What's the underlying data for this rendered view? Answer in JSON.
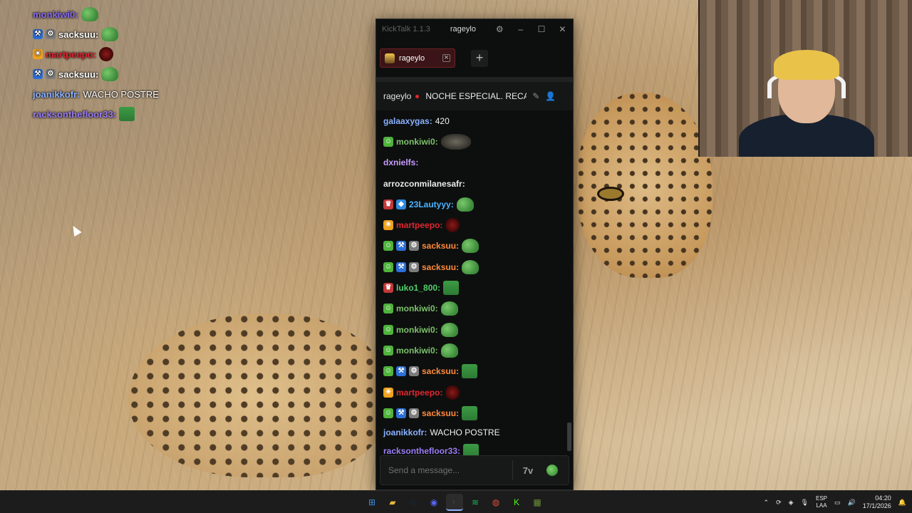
{
  "overlay_chat": [
    {
      "user": "monkiwi0:",
      "color": "#8a6cf0",
      "message": "",
      "emote": "frog",
      "badges": []
    },
    {
      "user": "sacksuu:",
      "color": "#ffffff",
      "message": "",
      "emote": "frog",
      "badges": [
        "pickaxe",
        "gear"
      ]
    },
    {
      "user": "martpeepo:",
      "color": "#e0262f",
      "message": "",
      "emote": "red",
      "badges": [
        "sun"
      ]
    },
    {
      "user": "sacksuu:",
      "color": "#ffffff",
      "message": "",
      "emote": "frog",
      "badges": [
        "pickaxe",
        "gear"
      ]
    },
    {
      "user": "joanikkofr:",
      "color": "#8ab0ff",
      "message": "WACHO POSTRE",
      "emote": "",
      "badges": []
    },
    {
      "user": "racksonthefloor33:",
      "color": "#9b7cf5",
      "message": "",
      "emote": "box",
      "badges": []
    }
  ],
  "kicktalk": {
    "app_title": "KickTalk 1.1.3",
    "username": "rageylo",
    "settings_icon": "gear-icon",
    "tab_label": "rageylo",
    "add_tab": "+",
    "channel": "rageylo",
    "stream_title": "NOCHE ESPECIAL. RECAP",
    "input_placeholder": "Send a message...",
    "accent": "#e0262f"
  },
  "messages": [
    {
      "user": "galaaxygas:",
      "color": "#8ab0ff",
      "text": "420",
      "badges": [],
      "emotes": []
    },
    {
      "user": "monkiwi0:",
      "color": "#7cc26b",
      "text": "",
      "badges": [
        "frog"
      ],
      "emotes": [
        "rock"
      ]
    },
    {
      "user": "dxnielfs:",
      "color": "#c89cff",
      "text": "",
      "badges": [],
      "emotes": [
        "small"
      ]
    },
    {
      "user": "arrozconmilanesafr:",
      "color": "#e8ebea",
      "text": "",
      "badges": [],
      "emotes": [
        "small"
      ]
    },
    {
      "user": "23Lautyyy:",
      "color": "#4ab3ff",
      "text": "",
      "badges": [
        "sub",
        "cube"
      ],
      "emotes": [
        "frog",
        "small"
      ]
    },
    {
      "user": "martpeepo:",
      "color": "#e0262f",
      "text": "",
      "badges": [
        "sun"
      ],
      "emotes": [
        "red"
      ]
    },
    {
      "user": "sacksuu:",
      "color": "#ff8a3d",
      "text": "",
      "badges": [
        "frog",
        "pickaxe",
        "gear"
      ],
      "emotes": [
        "frog"
      ]
    },
    {
      "user": "sacksuu:",
      "color": "#ff8a3d",
      "text": "",
      "badges": [
        "frog",
        "pickaxe",
        "gear"
      ],
      "emotes": [
        "frog"
      ]
    },
    {
      "user": "luko1_800:",
      "color": "#4fd06b",
      "text": "",
      "badges": [
        "sub"
      ],
      "emotes": [
        "box"
      ]
    },
    {
      "user": "monkiwi0:",
      "color": "#7cc26b",
      "text": "",
      "badges": [
        "frog"
      ],
      "emotes": [
        "frog"
      ]
    },
    {
      "user": "monkiwi0:",
      "color": "#7cc26b",
      "text": "",
      "badges": [
        "frog"
      ],
      "emotes": [
        "frog"
      ]
    },
    {
      "user": "monkiwi0:",
      "color": "#7cc26b",
      "text": "",
      "badges": [
        "frog"
      ],
      "emotes": [
        "frog"
      ]
    },
    {
      "user": "sacksuu:",
      "color": "#ff8a3d",
      "text": "",
      "badges": [
        "frog",
        "pickaxe",
        "gear"
      ],
      "emotes": [
        "box"
      ]
    },
    {
      "user": "martpeepo:",
      "color": "#e0262f",
      "text": "",
      "badges": [
        "sun"
      ],
      "emotes": [
        "red"
      ]
    },
    {
      "user": "sacksuu:",
      "color": "#ff8a3d",
      "text": "",
      "badges": [
        "frog",
        "pickaxe",
        "gear"
      ],
      "emotes": [
        "box"
      ]
    },
    {
      "user": "joanikkofr:",
      "color": "#8ab0ff",
      "text": "WACHO POSTRE",
      "badges": [],
      "emotes": []
    },
    {
      "user": "racksonthefloor33:",
      "color": "#9b7cf5",
      "text": "",
      "badges": [],
      "emotes": [
        "box"
      ]
    }
  ],
  "taskbar": {
    "apps": [
      "windows-start",
      "file-explorer",
      "steam",
      "discord",
      "obs",
      "spotify",
      "chrome",
      "kick",
      "minecraft"
    ],
    "language_top": "ESP",
    "language_bottom": "LAA",
    "time": "04:20",
    "date": "17/1/2026"
  }
}
